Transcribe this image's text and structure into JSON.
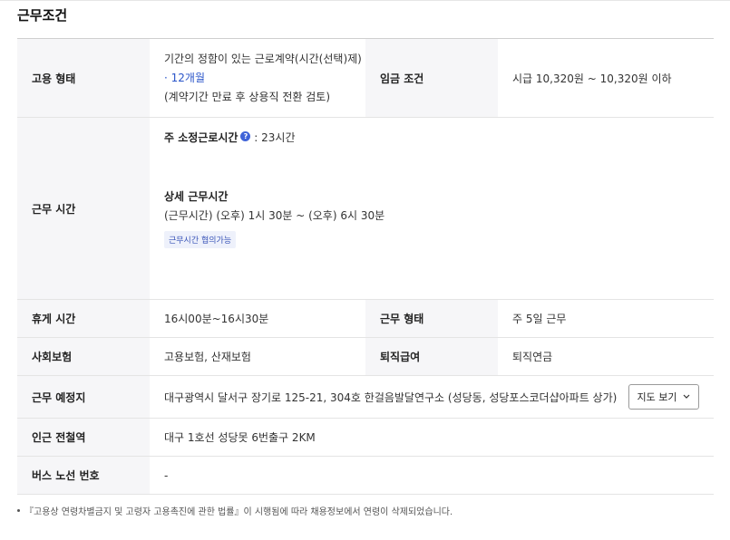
{
  "section_title": "근무조건",
  "rows": {
    "employment": {
      "label": "고용 형태",
      "line1": "기간의 정함이 있는 근로계약(시간(선택)제)",
      "line2": "· 12개월",
      "line3": "(계약기간 만료 후 상용직 전환 검토)",
      "wage_label": "임금 조건",
      "wage_value": "시급 10,320원 ~ 10,320원 이하"
    },
    "hours": {
      "label": "근무 시간",
      "weekly_title": "주 소정근로시간",
      "help_glyph": "?",
      "weekly_value": ": 23시간",
      "detail_title": "상세 근무시간",
      "detail_value": "(근무시간) (오후) 1시 30분 ~ (오후) 6시 30분",
      "tag": "근무시간 협의가능"
    },
    "break": {
      "label": "휴게 시간",
      "value": "16시00분~16시30분",
      "type_label": "근무 형태",
      "type_value": "주 5일 근무"
    },
    "insurance": {
      "label": "사회보험",
      "value": "고용보험, 산재보험",
      "severance_label": "퇴직급여",
      "severance_value": "퇴직연금"
    },
    "location": {
      "label": "근무 예정지",
      "value": "대구광역시 달서구 장기로 125-21, 304호 한걸음발달연구소 (성당동, 성당포스코더샵아파트 상가)",
      "map_button": "지도 보기",
      "map_icon": "chevron-down-icon"
    },
    "subway": {
      "label": "인근 전철역",
      "value": "대구 1호선 성당못 6번출구 2KM"
    },
    "bus": {
      "label": "버스 노선 번호",
      "value": "-"
    }
  },
  "footnote": "『고용상 연령차별금지 및 고령자 고용촉진에 관한 법률』이 시행됨에 따라 채용정보에서 연령이 삭제되었습니다."
}
